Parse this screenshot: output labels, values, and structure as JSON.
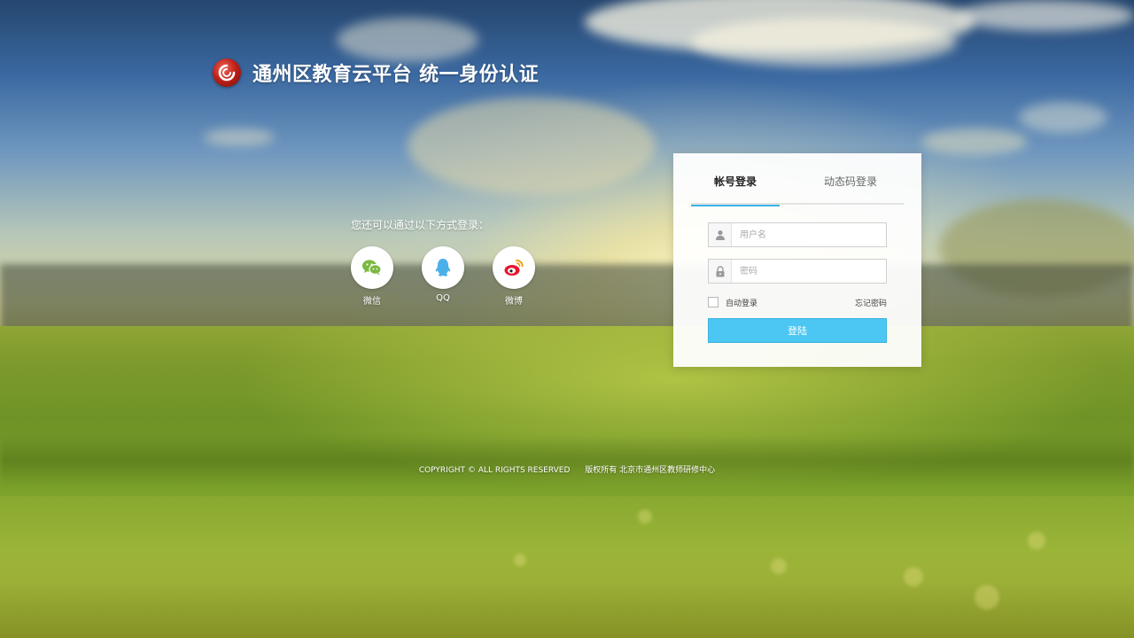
{
  "brand": {
    "title": "通州区教育云平台 统一身份认证",
    "logo_icon": "swirl-logo-icon"
  },
  "social": {
    "title": "您还可以通过以下方式登录：",
    "items": [
      {
        "label": "微信",
        "icon": "wechat-icon",
        "color": "#7bb841"
      },
      {
        "label": "QQ",
        "icon": "qq-icon",
        "color": "#4bb0ea"
      },
      {
        "label": "微博",
        "icon": "weibo-icon",
        "color": "#e6162d"
      }
    ]
  },
  "login": {
    "tabs": [
      {
        "label": "帐号登录",
        "active": true
      },
      {
        "label": "动态码登录",
        "active": false
      }
    ],
    "username": {
      "placeholder": "用户名",
      "value": "",
      "icon": "user-icon"
    },
    "password": {
      "placeholder": "密码",
      "value": "",
      "icon": "lock-icon"
    },
    "remember": {
      "label": "自动登录",
      "checked": false
    },
    "forgot_label": "忘记密码",
    "submit_label": "登陆",
    "accent_color": "#4cc6f2"
  },
  "footer": {
    "copyright": "COPYRIGHT © ALL RIGHTS RESERVED",
    "owner": "版权所有  北京市通州区教师研修中心"
  }
}
